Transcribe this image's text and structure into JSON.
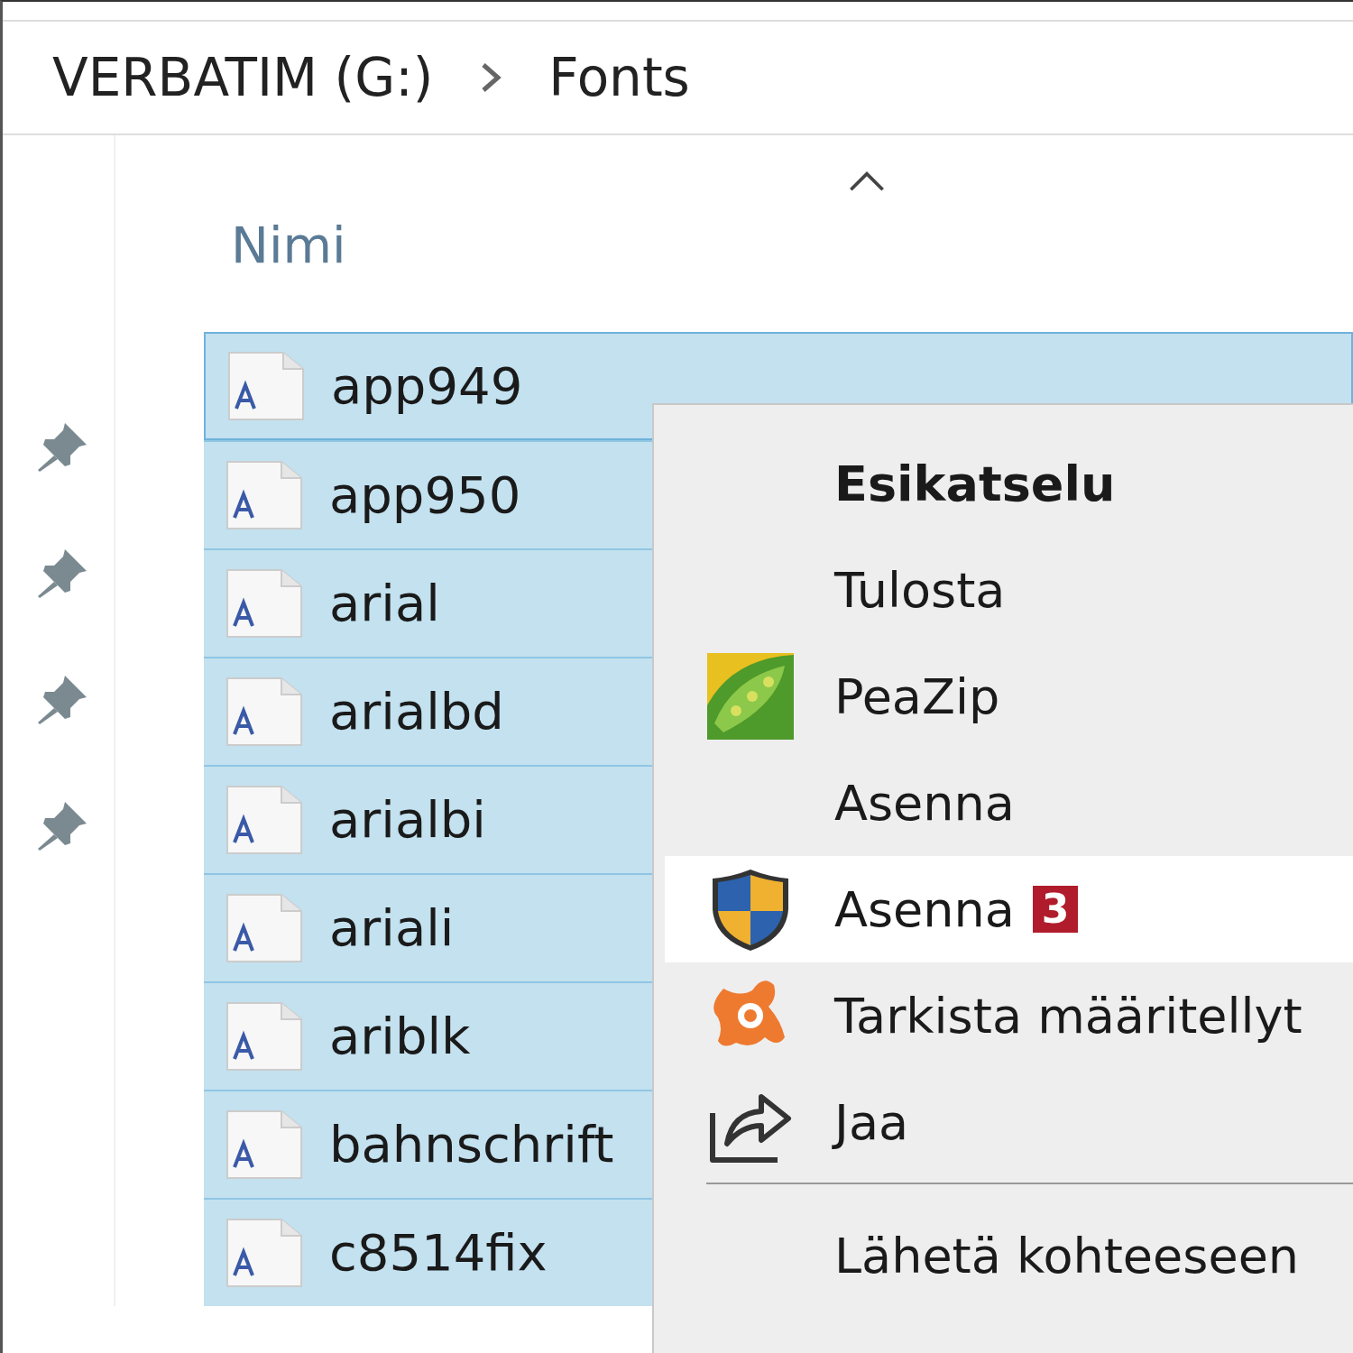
{
  "breadcrumb": [
    {
      "label": "VERBATIM (G:)"
    },
    {
      "label": "Fonts"
    }
  ],
  "quick_access": [
    {
      "pinned": true
    },
    {
      "pinned": true
    },
    {
      "pinned": true
    },
    {
      "pinned": true
    }
  ],
  "column_header": {
    "label": "Nimi",
    "sorted": true
  },
  "files": [
    {
      "name": "app949",
      "selected": true,
      "focused": true
    },
    {
      "name": "app950",
      "selected": true,
      "focused": false
    },
    {
      "name": "arial",
      "selected": true,
      "focused": false
    },
    {
      "name": "arialbd",
      "selected": true,
      "focused": false
    },
    {
      "name": "arialbi",
      "selected": true,
      "focused": false
    },
    {
      "name": "ariali",
      "selected": true,
      "focused": false
    },
    {
      "name": "ariblk",
      "selected": true,
      "focused": false
    },
    {
      "name": "bahnschrift",
      "selected": true,
      "focused": false
    },
    {
      "name": "c8514fix",
      "selected": true,
      "focused": false
    }
  ],
  "context_menu": {
    "items": [
      {
        "kind": "text",
        "label": "Esikatselu",
        "bold": true,
        "selected": false
      },
      {
        "kind": "text",
        "label": "Tulosta",
        "bold": false,
        "selected": false
      },
      {
        "kind": "pea",
        "label": "PeaZip",
        "bold": false,
        "selected": false
      },
      {
        "kind": "text",
        "label": "Asenna",
        "bold": false,
        "selected": false
      },
      {
        "kind": "shield",
        "label": "Asenna",
        "badge": "3",
        "bold": false,
        "selected": true
      },
      {
        "kind": "splat",
        "label": "Tarkista määritellyt",
        "bold": false,
        "selected": false
      },
      {
        "kind": "share",
        "label": "Jaa",
        "bold": false,
        "selected": false
      },
      {
        "kind": "separator"
      },
      {
        "kind": "text",
        "label": "Lähetä kohteeseen",
        "bold": false,
        "selected": false
      }
    ]
  }
}
